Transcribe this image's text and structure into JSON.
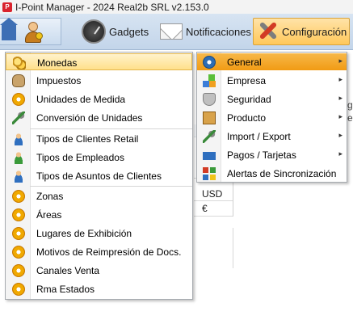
{
  "window": {
    "title": "I-Point Manager - 2024 Real2b SRL v2.153.0"
  },
  "ribbon": {
    "gadgets_label": "Gadgets",
    "notificaciones_label": "Notificaciones",
    "configuracion_label": "Configuración"
  },
  "background": {
    "cell_currency_code": "USD",
    "cell_currency_symbol": "€",
    "right_peek_1": "g",
    "right_peek_2": "e"
  },
  "menu_left": {
    "items": [
      {
        "label": "Monedas",
        "icon": "coins-icon",
        "highlighted": true
      },
      {
        "label": "Impuestos",
        "icon": "money-bag-icon"
      },
      {
        "label": "Unidades de Medida",
        "icon": "gear-icon"
      },
      {
        "label": "Conversión de Unidades",
        "icon": "ruler-icon"
      },
      {
        "label": "Tipos de Clientes Retail",
        "icon": "person-icon"
      },
      {
        "label": "Tipos de Empleados",
        "icon": "person-icon"
      },
      {
        "label": "Tipos de Asuntos de Clientes",
        "icon": "person-icon"
      },
      {
        "label": "Zonas",
        "icon": "gear-icon"
      },
      {
        "label": "Áreas",
        "icon": "gear-icon"
      },
      {
        "label": "Lugares de Exhibición",
        "icon": "gear-icon"
      },
      {
        "label": "Motivos de Reimpresión de Docs.",
        "icon": "gear-icon"
      },
      {
        "label": "Canales Venta",
        "icon": "gear-icon"
      },
      {
        "label": "Rma Estados",
        "icon": "gear-icon"
      }
    ]
  },
  "menu_right": {
    "items": [
      {
        "label": "General",
        "icon": "blue-gear-icon",
        "has_submenu": true,
        "highlighted": true
      },
      {
        "label": "Empresa",
        "icon": "cubes-icon",
        "has_submenu": true
      },
      {
        "label": "Seguridad",
        "icon": "shield-icon",
        "has_submenu": true
      },
      {
        "label": "Producto",
        "icon": "box-icon",
        "has_submenu": true
      },
      {
        "label": "Import / Export",
        "icon": "ruler-icon",
        "has_submenu": true
      },
      {
        "label": "Pagos / Tarjetas",
        "icon": "card-icon",
        "has_submenu": true
      },
      {
        "label": "Alertas de Sincronización",
        "icon": "sync-icon",
        "has_submenu": false
      }
    ]
  },
  "glyphs": {
    "submenu_arrow": "▸",
    "app_icon_letter": "P"
  },
  "colors": {
    "highlight_left": "#ffe08a",
    "highlight_right": "#f19b14",
    "ribbon_bg": "#c3d5ea",
    "config_button": "#ffc85a"
  }
}
